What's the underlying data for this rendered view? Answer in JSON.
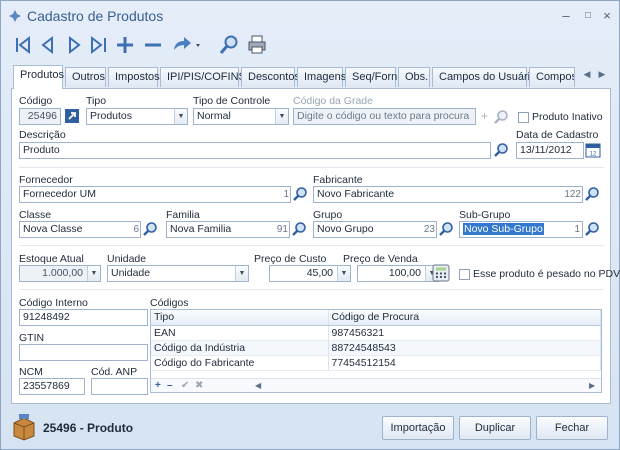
{
  "window": {
    "title": "Cadastro de Produtos"
  },
  "tabs": [
    {
      "label": "Produtos"
    },
    {
      "label": "Outros"
    },
    {
      "label": "Impostos"
    },
    {
      "label": "IPI/PIS/COFINS"
    },
    {
      "label": "Descontos"
    },
    {
      "label": "Imagens"
    },
    {
      "label": "Seq/Forn"
    },
    {
      "label": "Obs."
    },
    {
      "label": "Campos do Usuário"
    },
    {
      "label": "Composiçã"
    }
  ],
  "form": {
    "codigo": {
      "label": "Código",
      "value": "25496"
    },
    "tipo": {
      "label": "Tipo",
      "value": "Produtos"
    },
    "tipo_controle": {
      "label": "Tipo de Controle",
      "value": "Normal"
    },
    "codigo_grade": {
      "label": "Código da Grade",
      "placeholder": "Digite o código ou texto para procura"
    },
    "produto_inativo": {
      "label": "Produto Inativo",
      "checked": false
    },
    "descricao": {
      "label": "Descrição",
      "value": "Produto"
    },
    "data_cadastro": {
      "label": "Data de Cadastro",
      "value": "13/11/2012"
    },
    "fornecedor": {
      "label": "Fornecedor",
      "value": "Fornecedor UM",
      "id": "1"
    },
    "fabricante": {
      "label": "Fabricante",
      "value": "Novo Fabricante",
      "id": "122"
    },
    "classe": {
      "label": "Classe",
      "value": "Nova Classe",
      "id": "6"
    },
    "familia": {
      "label": "Familia",
      "value": "Nova Familia",
      "id": "91"
    },
    "grupo": {
      "label": "Grupo",
      "value": "Novo Grupo",
      "id": "23"
    },
    "sub_grupo": {
      "label": "Sub-Grupo",
      "value": "Novo Sub-Grupo",
      "id": "1"
    },
    "estoque_atual": {
      "label": "Estoque Atual",
      "value": "1.000,00"
    },
    "unidade": {
      "label": "Unidade",
      "value": "Unidade"
    },
    "preco_custo": {
      "label": "Preço de Custo",
      "value": "45,00"
    },
    "preco_venda": {
      "label": "Preço de Venda",
      "value": "100,00"
    },
    "pesado_pdv": {
      "label": "Esse produto é pesado no PDV",
      "checked": false
    },
    "codigo_interno": {
      "label": "Código Interno",
      "value": "91248492"
    },
    "gtin": {
      "label": "GTIN",
      "value": ""
    },
    "ncm": {
      "label": "NCM",
      "value": "23557869"
    },
    "cod_anp": {
      "label": "Cód. ANP",
      "value": ""
    }
  },
  "codigos": {
    "label": "Códigos",
    "columns": [
      "Tipo",
      "Código de Procura"
    ],
    "rows": [
      {
        "tipo": "EAN",
        "codigo": "987456321"
      },
      {
        "tipo": "Código da Indústria",
        "codigo": "88724548543"
      },
      {
        "tipo": "Código do Fabricante",
        "codigo": "77454512154"
      }
    ]
  },
  "footer": {
    "product_code": "25496",
    "product_name": "Produto",
    "buttons": {
      "importacao": "Importação",
      "duplicar": "Duplicar",
      "fechar": "Fechar"
    }
  },
  "colors": {
    "accent": "#3378cf",
    "title": "#3a5f8f",
    "border": "#9eb2cc"
  }
}
